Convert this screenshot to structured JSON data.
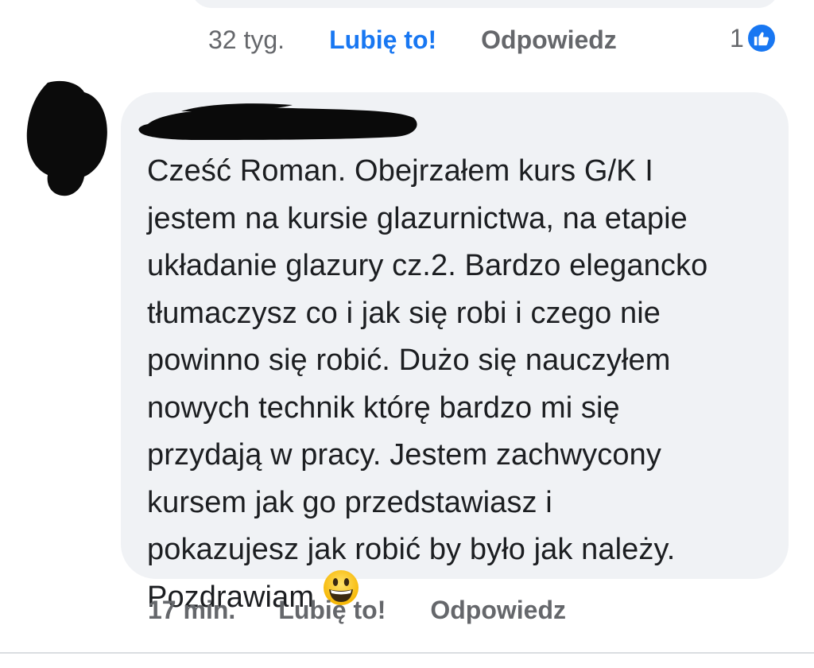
{
  "previous_comment": {
    "time": "32 tyg.",
    "like_label": "Lubię to!",
    "reply_label": "Odpowiedz",
    "reaction_count": "1",
    "reaction_icon": "thumbs-up-icon"
  },
  "comment": {
    "lines": [
      "Cześć Roman. Obejrzałem kurs G/K I",
      "jestem na kursie glazurnictwa, na etapie",
      "układanie glazury cz.2. Bardzo elegancko",
      "tłumaczysz co i jak się robi i czego nie",
      "powinno się robić. Dużo się nauczyłem",
      "nowych technik którę bardzo mi się",
      "przydają w pracy. Jestem zachwycony",
      "kursem jak go przedstawiasz i",
      "pokazujesz jak robić by było jak należy.",
      "Pozdrawiam"
    ],
    "emoji": "grinning-face-emoji",
    "time": "17 min.",
    "like_label": "Lubię to!",
    "reply_label": "Odpowiedz"
  },
  "colors": {
    "bubble": "#f0f2f5",
    "accent": "#1877f2",
    "muted": "#65676b",
    "text": "#1c1e21"
  }
}
